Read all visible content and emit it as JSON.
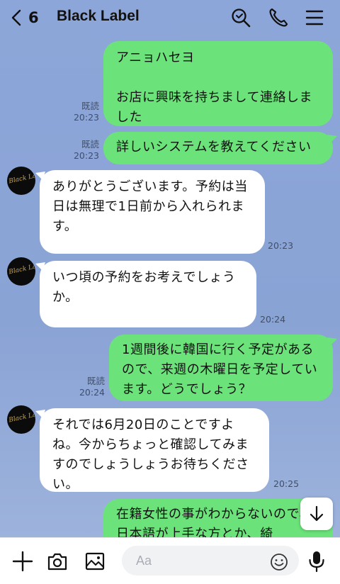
{
  "header": {
    "unread_count": "6",
    "title": "Black Label"
  },
  "avatar": {
    "text": "Black Label"
  },
  "messages": [
    {
      "from": "me",
      "text": "アニョハセヨ\n\nお店に興味を持ちまして連絡しました",
      "read": "既読",
      "time": "20:23"
    },
    {
      "from": "me",
      "text": "詳しいシステムを教えてください",
      "read": "既読",
      "time": "20:23"
    },
    {
      "from": "them",
      "text": "ありがとうございます。予約は当日は無理で1日前から入れられます。",
      "time": "20:23"
    },
    {
      "from": "them",
      "text": "いつ頃の予約をお考えでしょうか。",
      "time": "20:24"
    },
    {
      "from": "me",
      "text": "1週間後に韓国に行く予定があるので、来週の木曜日を予定しています。どうでしょう？",
      "read": "既読",
      "time": "20:24"
    },
    {
      "from": "them",
      "text": "それでは6月20日のことですよね。今からちょっと確認してみますのでしょうしょうお待ちください。",
      "time": "20:25"
    },
    {
      "from": "me",
      "text": "在籍女性の事がわからないので、日本語が上手な方とか、綺"
    }
  ],
  "input": {
    "placeholder": "Aa"
  },
  "colors": {
    "my_bubble": "#6ce27a",
    "their_bubble": "#ffffff",
    "background": "#8aa4d6"
  }
}
